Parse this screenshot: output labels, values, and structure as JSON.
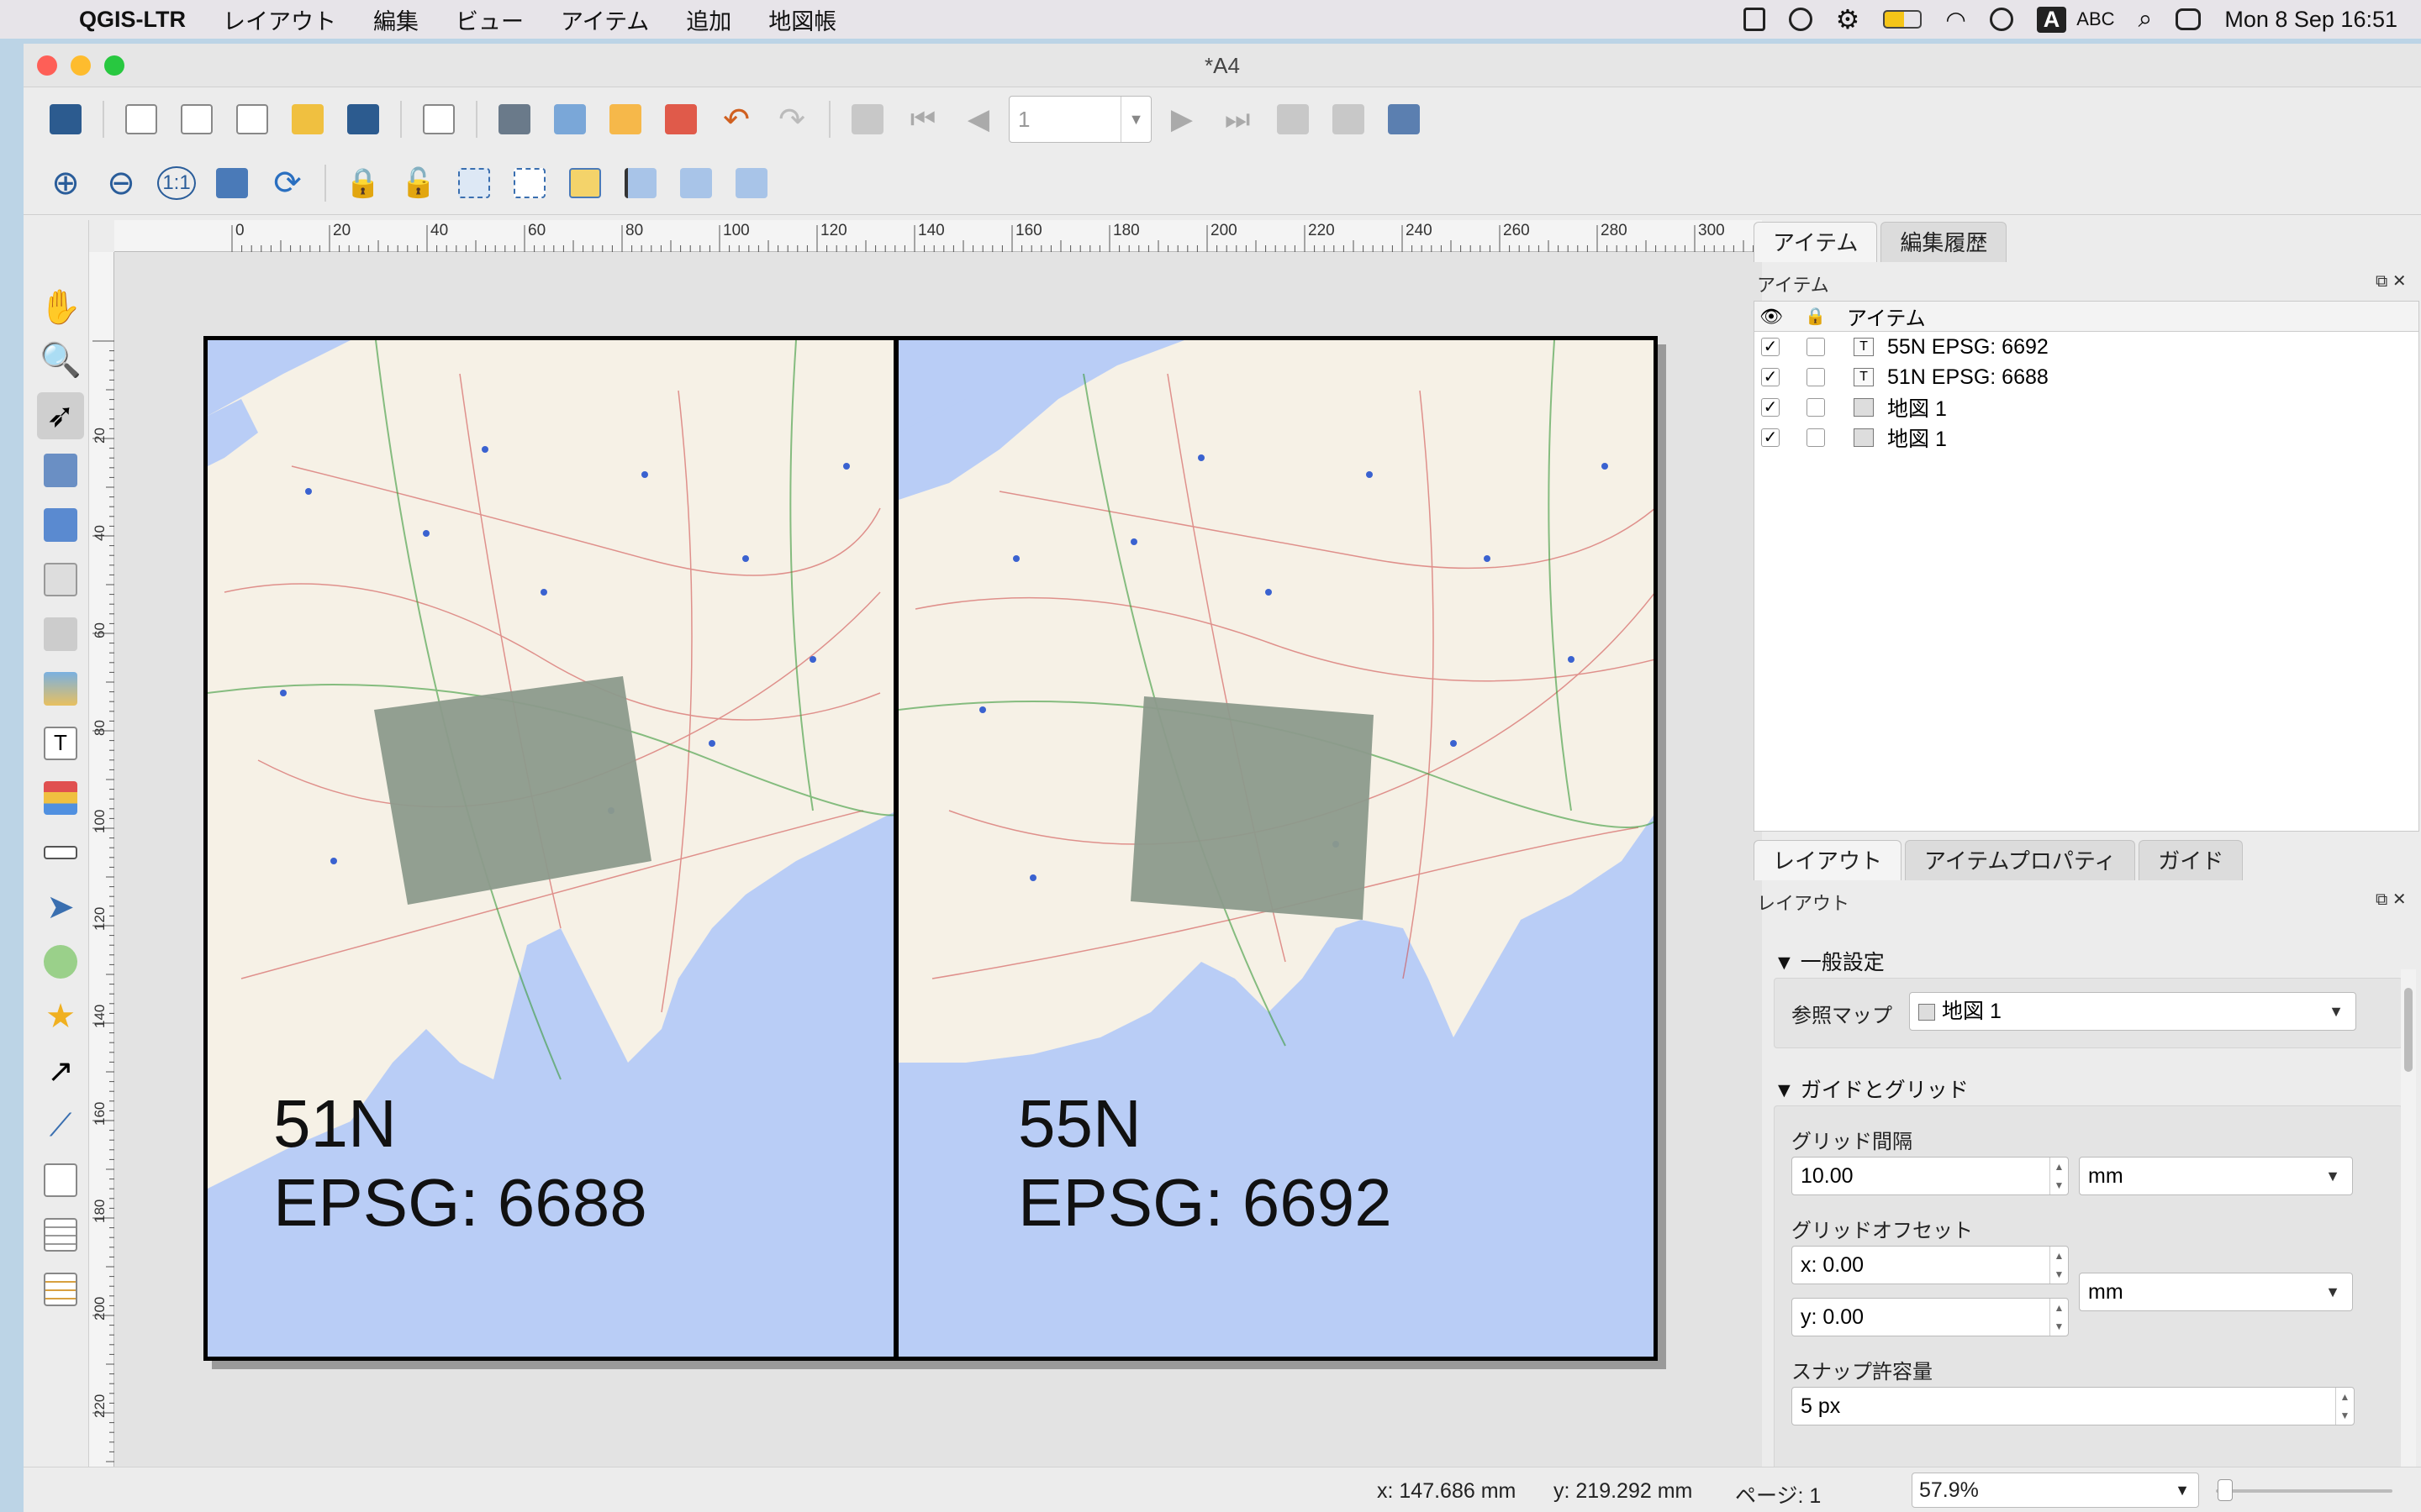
{
  "menubar": {
    "app_name": "QGIS-LTR",
    "items": [
      "レイアウト",
      "編集",
      "ビュー",
      "アイテム",
      "追加",
      "地図帳"
    ],
    "input_mode": "A",
    "input_source": "ABC",
    "datetime": "Mon 8 Sep  16:51"
  },
  "window": {
    "title": "*A4"
  },
  "toolbar": {
    "page_number": "1"
  },
  "ruler": {
    "h_ticks": [
      "0",
      "20",
      "40",
      "60",
      "80",
      "100",
      "120",
      "140",
      "160",
      "180",
      "200",
      "220",
      "240",
      "260",
      "280",
      "300"
    ],
    "v_ticks": [
      "20",
      "40",
      "60",
      "80",
      "100",
      "120",
      "140",
      "160",
      "180",
      "200",
      "220"
    ]
  },
  "map": {
    "left_label_line1": "51N",
    "left_label_line2": "EPSG: 6688",
    "right_label_line1": "55N",
    "right_label_line2": "EPSG: 6692"
  },
  "items_panel": {
    "tabs": [
      "アイテム",
      "編集履歴"
    ],
    "header": "アイテム",
    "column_item": "アイテム",
    "rows": [
      {
        "type": "T",
        "label": "55N EPSG: 6692"
      },
      {
        "type": "T",
        "label": "51N EPSG: 6688"
      },
      {
        "type": "map",
        "label": "地図 1"
      },
      {
        "type": "map",
        "label": "地図 1"
      }
    ]
  },
  "layout_panel": {
    "tabs": [
      "レイアウト",
      "アイテムプロパティ",
      "ガイド"
    ],
    "header": "レイアウト",
    "general_section": "一般設定",
    "reference_map_label": "参照マップ",
    "reference_map_value": "地図 1",
    "guides_section": "ガイドとグリッド",
    "grid_spacing_label": "グリッド間隔",
    "grid_spacing_value": "10.00",
    "grid_spacing_unit": "mm",
    "grid_offset_label": "グリッドオフセット",
    "offset_x": "x: 0.00",
    "offset_y": "y: 0.00",
    "offset_unit": "mm",
    "snap_label": "スナップ許容量",
    "snap_value": "5 px"
  },
  "status": {
    "x": "x: 147.686 mm",
    "y": "y: 219.292 mm",
    "page": "ページ: 1",
    "zoom": "57.9%"
  },
  "colors": {
    "water": "#b9cdf6",
    "land": "#f6f1e6",
    "overlay": "#8c9a8c"
  }
}
